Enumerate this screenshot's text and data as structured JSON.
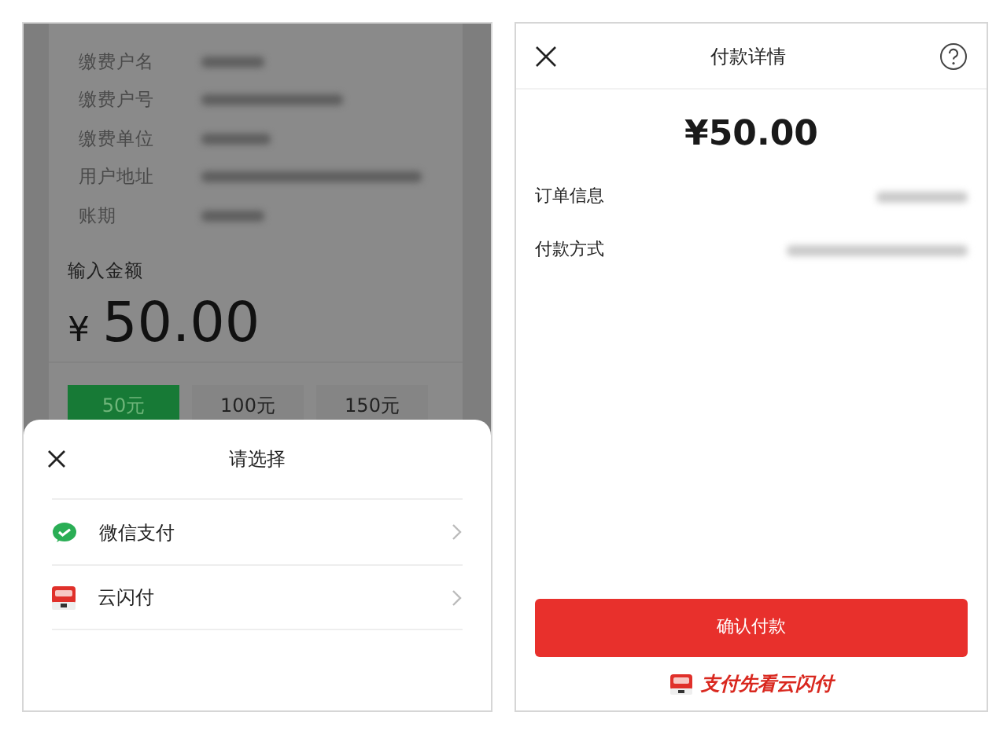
{
  "left_screen": {
    "bill_fields": [
      {
        "label": "缴费户名"
      },
      {
        "label": "缴费户号"
      },
      {
        "label": "缴费单位"
      },
      {
        "label": "用户地址"
      },
      {
        "label": "账期"
      }
    ],
    "amount_label": "输入金额",
    "currency": "¥",
    "amount": "50.00",
    "amount_options": [
      {
        "label": "50元",
        "selected": true
      },
      {
        "label": "100元",
        "selected": false
      },
      {
        "label": "150元",
        "selected": false
      }
    ],
    "sheet": {
      "title": "请选择",
      "options": [
        {
          "label": "微信支付",
          "kind": "wechat"
        },
        {
          "label": "云闪付",
          "kind": "unionpay"
        }
      ]
    }
  },
  "right_screen": {
    "title": "付款详情",
    "amount": "¥50.00",
    "rows": [
      {
        "label": "订单信息"
      },
      {
        "label": "付款方式"
      }
    ],
    "confirm_button": "确认付款",
    "slogan": "支付先看云闪付"
  }
}
